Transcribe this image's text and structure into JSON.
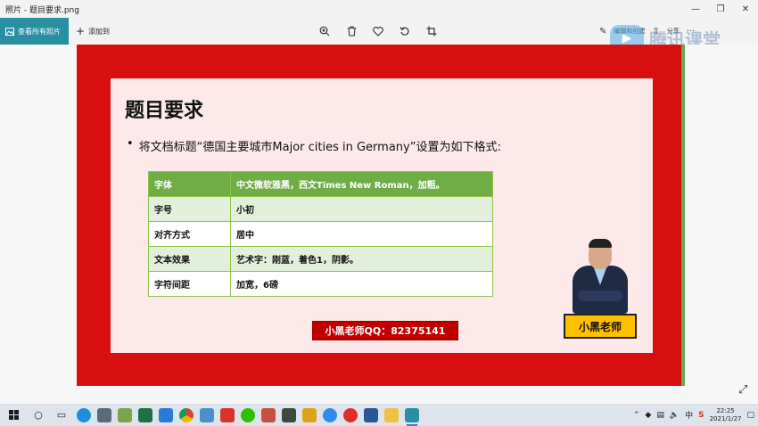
{
  "window": {
    "title": "照片 - 题目要求.png",
    "minimize": "—",
    "restore": "❐",
    "close": "✕"
  },
  "toolbar": {
    "view_all": "查看所有照片",
    "add_to": "添加到",
    "edit_create": "编辑和创建",
    "share": "分享",
    "more": "···"
  },
  "watermark": {
    "text": "腾讯课堂"
  },
  "slide": {
    "title": "题目要求",
    "bullet": "将文档标题“德国主要城市Major cities in Germany”设置为如下格式:",
    "table": [
      [
        "字体",
        "中文微软雅黑，西文Times New Roman，加粗。"
      ],
      [
        "字号",
        "小初"
      ],
      [
        "对齐方式",
        "居中"
      ],
      [
        "文本效果",
        "艺术字：刚蓝，着色1，阴影。"
      ],
      [
        "字符间距",
        "加宽，6磅"
      ]
    ],
    "qq_banner": "小黑老师QQ：82375141",
    "teacher_name": "小黑老师"
  },
  "colors": {
    "frame_red": "#d70f0f",
    "table_green": "#70ad47",
    "badge_yellow": "#ffc000",
    "accent_teal": "#2a8fa0"
  },
  "taskbar": {
    "tray_ime": "中",
    "time": "22:25",
    "date": "2021/1/27"
  }
}
